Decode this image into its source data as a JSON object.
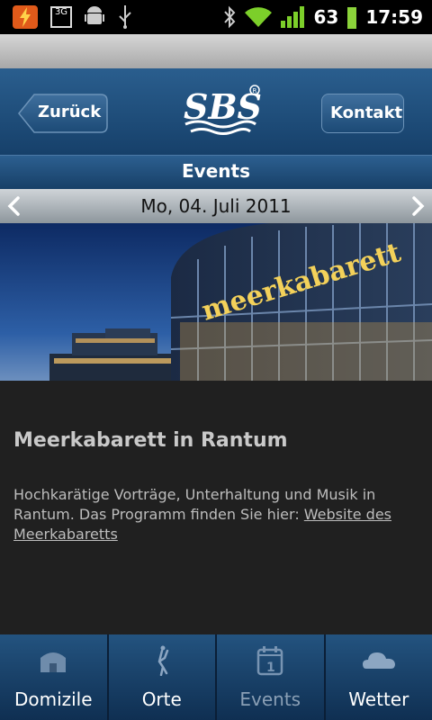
{
  "statusbar": {
    "network": "3G",
    "battery": "63",
    "time": "17:59"
  },
  "header": {
    "back_label": "Zurück",
    "contact_label": "Kontakt"
  },
  "section_title": "Events",
  "date_nav": {
    "date": "Mo, 04. Juli 2011"
  },
  "photo": {
    "sign_text": "meerkabarett"
  },
  "event": {
    "title": "Meerkabarett in Rantum",
    "description": "Hochkarätige Vorträge, Unterhaltung und Musik in Rantum. Das Programm finden Sie hier: ",
    "link_text": "Website des Meerkabaretts"
  },
  "tabs": [
    {
      "label": "Domizile",
      "icon": "house-icon"
    },
    {
      "label": "Orte",
      "icon": "figure-icon"
    },
    {
      "label": "Events",
      "icon": "calendar-icon"
    },
    {
      "label": "Wetter",
      "icon": "cloud-icon"
    }
  ]
}
